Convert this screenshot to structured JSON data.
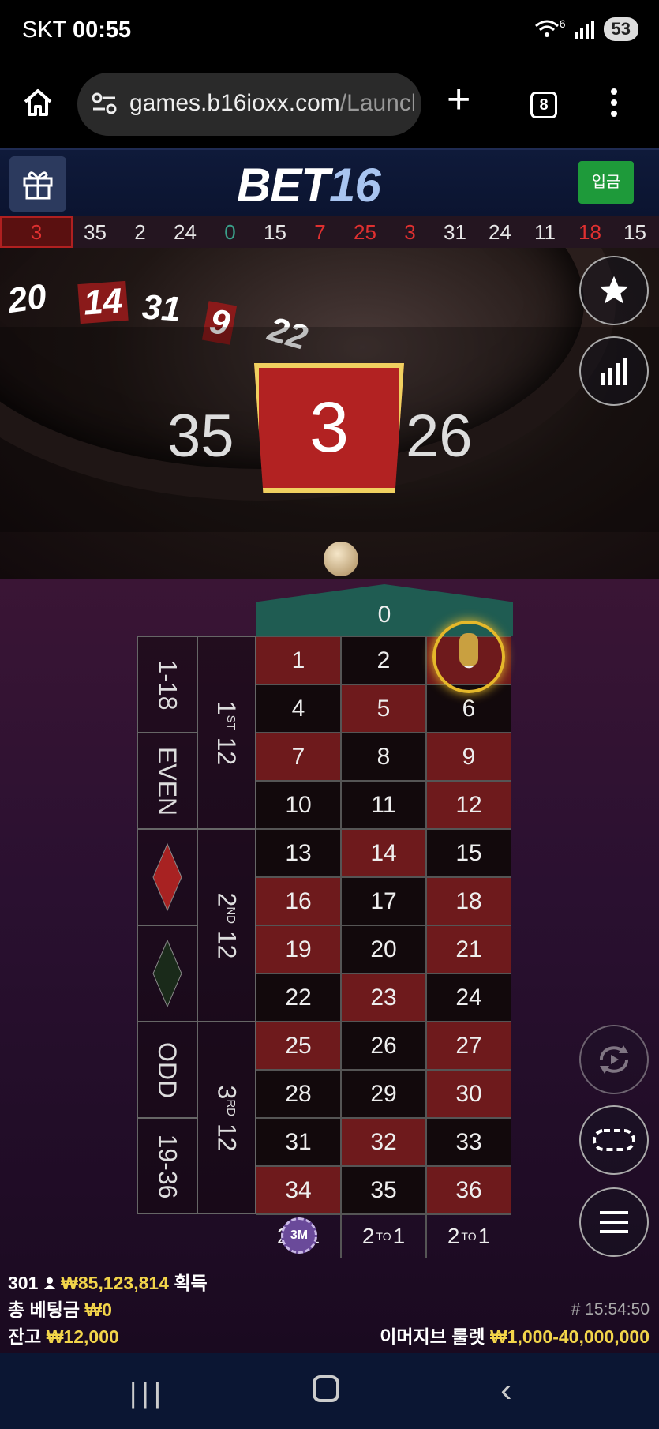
{
  "status_bar": {
    "carrier": "SKT",
    "time": "00:55",
    "wifi_badge": "6",
    "battery": "53"
  },
  "browser": {
    "url_main": "games.b16ioxx.com",
    "url_path": "/Launcl",
    "tab_count": "8",
    "icons": [
      "home-icon",
      "site-info-icon",
      "plus-icon",
      "tabs-icon",
      "more-icon"
    ]
  },
  "header": {
    "logo_text": "BET",
    "logo_num": "16",
    "deposit_label": "입금"
  },
  "history": [
    {
      "n": "3",
      "c": "red"
    },
    {
      "n": "35",
      "c": "black"
    },
    {
      "n": "2",
      "c": "black"
    },
    {
      "n": "24",
      "c": "black"
    },
    {
      "n": "0",
      "c": "green"
    },
    {
      "n": "15",
      "c": "black"
    },
    {
      "n": "7",
      "c": "red"
    },
    {
      "n": "25",
      "c": "red"
    },
    {
      "n": "3",
      "c": "red"
    },
    {
      "n": "31",
      "c": "black"
    },
    {
      "n": "24",
      "c": "black"
    },
    {
      "n": "11",
      "c": "black"
    },
    {
      "n": "18",
      "c": "red"
    },
    {
      "n": "15",
      "c": "black"
    }
  ],
  "wheel_pockets": [
    "20",
    "14",
    "31",
    "9",
    "22"
  ],
  "result": {
    "prev": "35",
    "current": "3",
    "next": "26"
  },
  "table": {
    "zero": "0",
    "numbers": [
      {
        "n": "1",
        "c": "red"
      },
      {
        "n": "2",
        "c": "black"
      },
      {
        "n": "3",
        "c": "red"
      },
      {
        "n": "4",
        "c": "black"
      },
      {
        "n": "5",
        "c": "red"
      },
      {
        "n": "6",
        "c": "black"
      },
      {
        "n": "7",
        "c": "red"
      },
      {
        "n": "8",
        "c": "black"
      },
      {
        "n": "9",
        "c": "red"
      },
      {
        "n": "10",
        "c": "black"
      },
      {
        "n": "11",
        "c": "black"
      },
      {
        "n": "12",
        "c": "red"
      },
      {
        "n": "13",
        "c": "black"
      },
      {
        "n": "14",
        "c": "red"
      },
      {
        "n": "15",
        "c": "black"
      },
      {
        "n": "16",
        "c": "red"
      },
      {
        "n": "17",
        "c": "black"
      },
      {
        "n": "18",
        "c": "red"
      },
      {
        "n": "19",
        "c": "red"
      },
      {
        "n": "20",
        "c": "black"
      },
      {
        "n": "21",
        "c": "red"
      },
      {
        "n": "22",
        "c": "black"
      },
      {
        "n": "23",
        "c": "red"
      },
      {
        "n": "24",
        "c": "black"
      },
      {
        "n": "25",
        "c": "red"
      },
      {
        "n": "26",
        "c": "black"
      },
      {
        "n": "27",
        "c": "red"
      },
      {
        "n": "28",
        "c": "black"
      },
      {
        "n": "29",
        "c": "black"
      },
      {
        "n": "30",
        "c": "red"
      },
      {
        "n": "31",
        "c": "black"
      },
      {
        "n": "32",
        "c": "red"
      },
      {
        "n": "33",
        "c": "black"
      },
      {
        "n": "34",
        "c": "red"
      },
      {
        "n": "35",
        "c": "black"
      },
      {
        "n": "36",
        "c": "red"
      }
    ],
    "column_bets": [
      {
        "a": "2",
        "sup": "TO",
        "b": "1"
      },
      {
        "a": "2",
        "sup": "TO",
        "b": "1"
      },
      {
        "a": "2",
        "sup": "TO",
        "b": "1"
      }
    ],
    "low": "1-18",
    "even": "EVEN",
    "odd": "ODD",
    "high": "19-36",
    "dozens": [
      {
        "num": "1",
        "sup": "ST",
        "label": "12"
      },
      {
        "num": "2",
        "sup": "ND",
        "label": "12"
      },
      {
        "num": "3",
        "sup": "RD",
        "label": "12"
      }
    ],
    "chip_label": "3M",
    "red_color": "#6e1a1c",
    "black_color": "#12090c"
  },
  "side_buttons": [
    "star-icon",
    "stats-icon",
    "rebet-icon",
    "racetrack-icon",
    "menu-icon"
  ],
  "info": {
    "players": "301",
    "winnings": "₩85,123,814",
    "winnings_label": "획득",
    "total_bet_label": "총 베팅금",
    "total_bet": "₩0",
    "balance_label": "잔고",
    "balance": "₩12,000",
    "game_id": "# 15:54:50",
    "table_name": "이머지브 룰렛",
    "limits": "₩1,000-40,000,000"
  },
  "colors": {
    "accent_gold": "#f2d44a",
    "deposit_green": "#1e9a3a",
    "header_bg": "#0f1a3a"
  }
}
